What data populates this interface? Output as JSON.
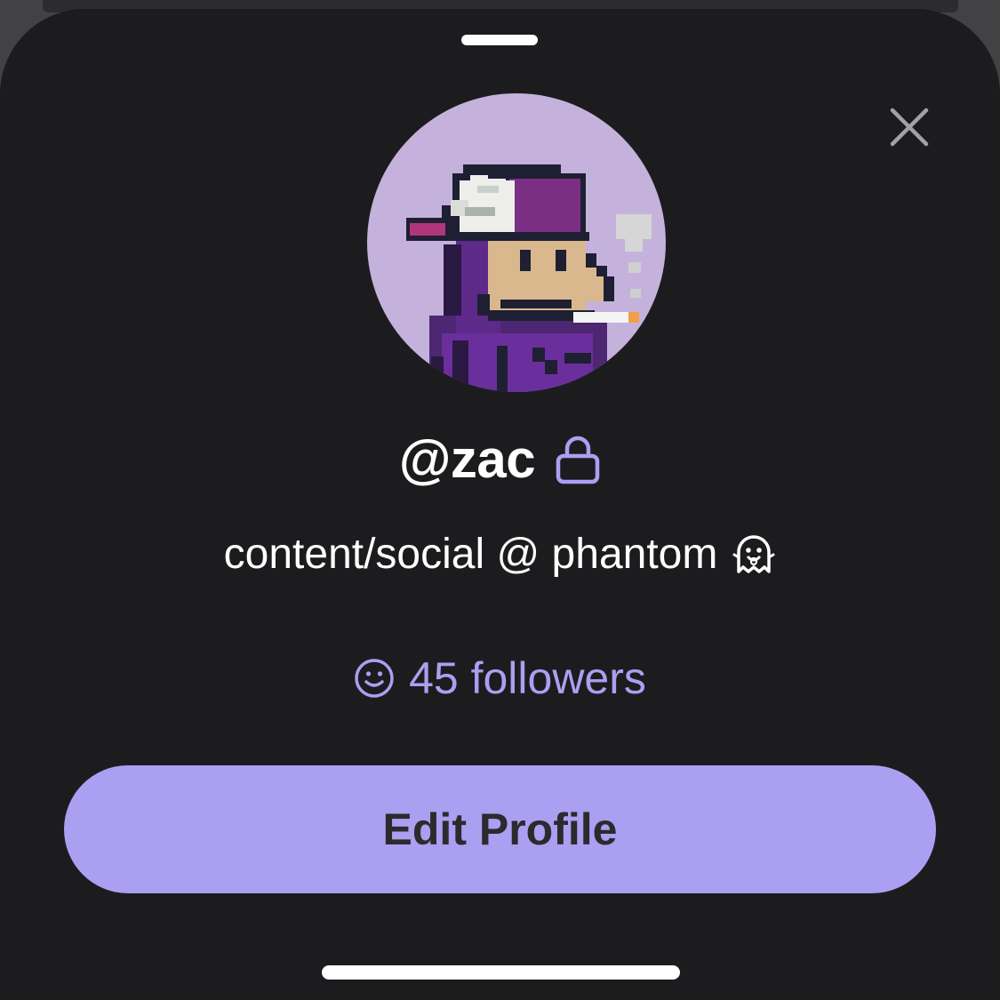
{
  "sheet": {
    "background_color": "#1c1c1e",
    "accent_color": "#ab9ff2"
  },
  "header": {
    "close_icon": "close-icon"
  },
  "profile": {
    "avatar_icon": "pixel-art-avatar",
    "avatar_background": "#c4b2dc",
    "username": "@zac",
    "lock_icon": "lock-icon",
    "bio": "content/social @ phantom",
    "bio_emoji_icon": "ghost-icon",
    "followers_icon": "smiley-icon",
    "followers_label": "45 followers"
  },
  "actions": {
    "edit_profile_label": "Edit Profile"
  }
}
